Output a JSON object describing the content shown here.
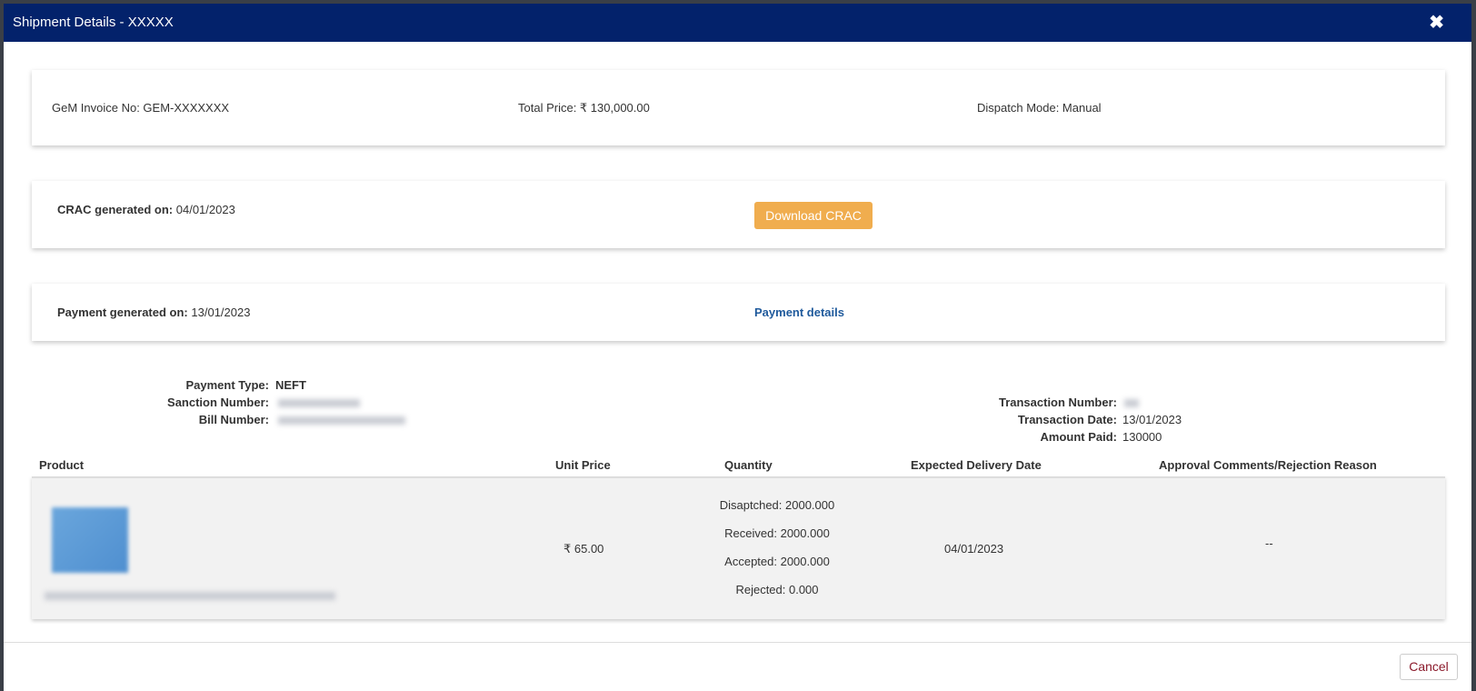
{
  "modal": {
    "title": "Shipment Details - XXXXX",
    "close_icon": "close-icon"
  },
  "summary": {
    "invoice": "GeM Invoice No: GEM-XXXXXXX",
    "total_price": "Total Price: ₹ 130,000.00",
    "dispatch_mode": "Dispatch Mode: Manual"
  },
  "crac": {
    "label": "CRAC generated on:",
    "date": "04/01/2023",
    "button": "Download CRAC",
    "button_color": "#f0ad4e"
  },
  "payment": {
    "label": "Payment generated on:",
    "date": "13/01/2023",
    "link": "Payment details"
  },
  "payment_info": {
    "type_label": "Payment Type:",
    "type_value": "NEFT",
    "sanction_label": "Sanction Number:",
    "bill_label": "Bill Number:",
    "txn_number_label": "Transaction Number:",
    "txn_date_label": "Transaction Date:",
    "txn_date_value": "13/01/2023",
    "amount_label": "Amount Paid:",
    "amount_value": "130000"
  },
  "table": {
    "headers": [
      "Product",
      "Unit Price",
      "Quantity",
      "Expected Delivery Date",
      "Approval Comments/Rejection Reason"
    ],
    "rows": [
      {
        "unit_price": "₹ 65.00",
        "dispatched": "Disaptched: 2000.000",
        "received": "Received: 2000.000",
        "accepted": "Accepted: 2000.000",
        "rejected": "Rejected: 0.000",
        "delivery_date": "04/01/2023",
        "comments": "--"
      }
    ]
  },
  "footer": {
    "cancel": "Cancel"
  },
  "colors": {
    "header": "#03226b",
    "link": "#1f5a9c",
    "cancel_text": "#8b1a2b"
  }
}
